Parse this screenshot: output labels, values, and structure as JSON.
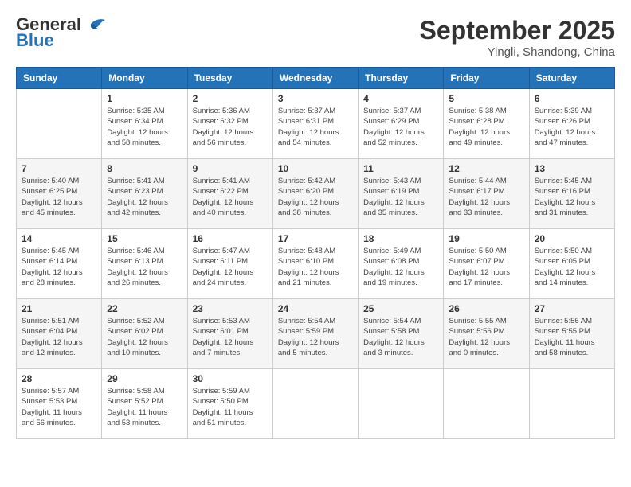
{
  "header": {
    "logo_general": "General",
    "logo_blue": "Blue",
    "month": "September 2025",
    "location": "Yingli, Shandong, China"
  },
  "days_of_week": [
    "Sunday",
    "Monday",
    "Tuesday",
    "Wednesday",
    "Thursday",
    "Friday",
    "Saturday"
  ],
  "weeks": [
    [
      {
        "day": "",
        "info": ""
      },
      {
        "day": "1",
        "info": "Sunrise: 5:35 AM\nSunset: 6:34 PM\nDaylight: 12 hours\nand 58 minutes."
      },
      {
        "day": "2",
        "info": "Sunrise: 5:36 AM\nSunset: 6:32 PM\nDaylight: 12 hours\nand 56 minutes."
      },
      {
        "day": "3",
        "info": "Sunrise: 5:37 AM\nSunset: 6:31 PM\nDaylight: 12 hours\nand 54 minutes."
      },
      {
        "day": "4",
        "info": "Sunrise: 5:37 AM\nSunset: 6:29 PM\nDaylight: 12 hours\nand 52 minutes."
      },
      {
        "day": "5",
        "info": "Sunrise: 5:38 AM\nSunset: 6:28 PM\nDaylight: 12 hours\nand 49 minutes."
      },
      {
        "day": "6",
        "info": "Sunrise: 5:39 AM\nSunset: 6:26 PM\nDaylight: 12 hours\nand 47 minutes."
      }
    ],
    [
      {
        "day": "7",
        "info": "Sunrise: 5:40 AM\nSunset: 6:25 PM\nDaylight: 12 hours\nand 45 minutes."
      },
      {
        "day": "8",
        "info": "Sunrise: 5:41 AM\nSunset: 6:23 PM\nDaylight: 12 hours\nand 42 minutes."
      },
      {
        "day": "9",
        "info": "Sunrise: 5:41 AM\nSunset: 6:22 PM\nDaylight: 12 hours\nand 40 minutes."
      },
      {
        "day": "10",
        "info": "Sunrise: 5:42 AM\nSunset: 6:20 PM\nDaylight: 12 hours\nand 38 minutes."
      },
      {
        "day": "11",
        "info": "Sunrise: 5:43 AM\nSunset: 6:19 PM\nDaylight: 12 hours\nand 35 minutes."
      },
      {
        "day": "12",
        "info": "Sunrise: 5:44 AM\nSunset: 6:17 PM\nDaylight: 12 hours\nand 33 minutes."
      },
      {
        "day": "13",
        "info": "Sunrise: 5:45 AM\nSunset: 6:16 PM\nDaylight: 12 hours\nand 31 minutes."
      }
    ],
    [
      {
        "day": "14",
        "info": "Sunrise: 5:45 AM\nSunset: 6:14 PM\nDaylight: 12 hours\nand 28 minutes."
      },
      {
        "day": "15",
        "info": "Sunrise: 5:46 AM\nSunset: 6:13 PM\nDaylight: 12 hours\nand 26 minutes."
      },
      {
        "day": "16",
        "info": "Sunrise: 5:47 AM\nSunset: 6:11 PM\nDaylight: 12 hours\nand 24 minutes."
      },
      {
        "day": "17",
        "info": "Sunrise: 5:48 AM\nSunset: 6:10 PM\nDaylight: 12 hours\nand 21 minutes."
      },
      {
        "day": "18",
        "info": "Sunrise: 5:49 AM\nSunset: 6:08 PM\nDaylight: 12 hours\nand 19 minutes."
      },
      {
        "day": "19",
        "info": "Sunrise: 5:50 AM\nSunset: 6:07 PM\nDaylight: 12 hours\nand 17 minutes."
      },
      {
        "day": "20",
        "info": "Sunrise: 5:50 AM\nSunset: 6:05 PM\nDaylight: 12 hours\nand 14 minutes."
      }
    ],
    [
      {
        "day": "21",
        "info": "Sunrise: 5:51 AM\nSunset: 6:04 PM\nDaylight: 12 hours\nand 12 minutes."
      },
      {
        "day": "22",
        "info": "Sunrise: 5:52 AM\nSunset: 6:02 PM\nDaylight: 12 hours\nand 10 minutes."
      },
      {
        "day": "23",
        "info": "Sunrise: 5:53 AM\nSunset: 6:01 PM\nDaylight: 12 hours\nand 7 minutes."
      },
      {
        "day": "24",
        "info": "Sunrise: 5:54 AM\nSunset: 5:59 PM\nDaylight: 12 hours\nand 5 minutes."
      },
      {
        "day": "25",
        "info": "Sunrise: 5:54 AM\nSunset: 5:58 PM\nDaylight: 12 hours\nand 3 minutes."
      },
      {
        "day": "26",
        "info": "Sunrise: 5:55 AM\nSunset: 5:56 PM\nDaylight: 12 hours\nand 0 minutes."
      },
      {
        "day": "27",
        "info": "Sunrise: 5:56 AM\nSunset: 5:55 PM\nDaylight: 11 hours\nand 58 minutes."
      }
    ],
    [
      {
        "day": "28",
        "info": "Sunrise: 5:57 AM\nSunset: 5:53 PM\nDaylight: 11 hours\nand 56 minutes."
      },
      {
        "day": "29",
        "info": "Sunrise: 5:58 AM\nSunset: 5:52 PM\nDaylight: 11 hours\nand 53 minutes."
      },
      {
        "day": "30",
        "info": "Sunrise: 5:59 AM\nSunset: 5:50 PM\nDaylight: 11 hours\nand 51 minutes."
      },
      {
        "day": "",
        "info": ""
      },
      {
        "day": "",
        "info": ""
      },
      {
        "day": "",
        "info": ""
      },
      {
        "day": "",
        "info": ""
      }
    ]
  ]
}
